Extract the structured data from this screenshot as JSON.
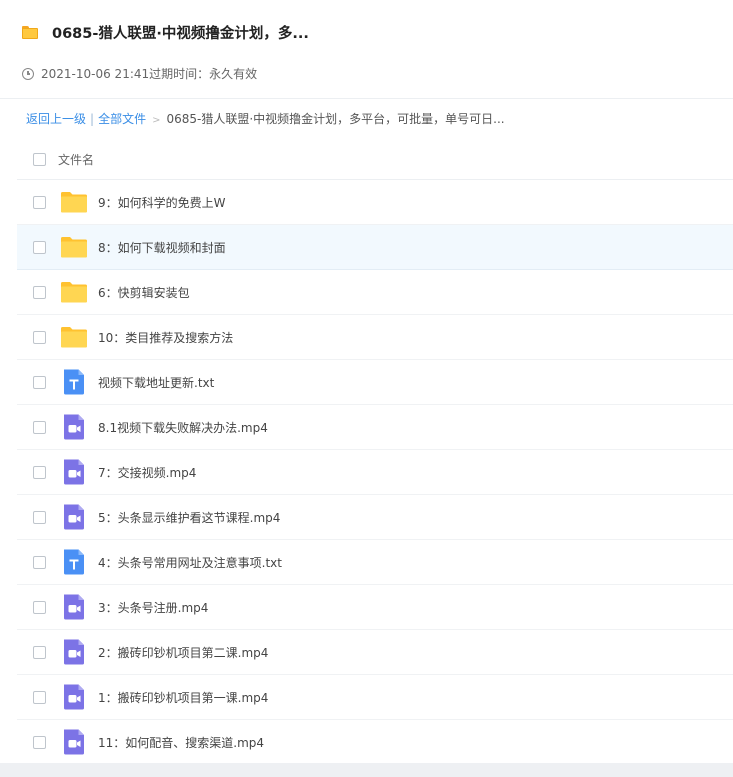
{
  "header": {
    "title": "0685-猎人联盟·中视频撸金计划，多...",
    "share_time": "2021-10-06 21:41",
    "expire_label": "过期时间：",
    "expire_value": "永久有效"
  },
  "breadcrumb": {
    "back": "返回上一级",
    "separator": "|",
    "all_files": "全部文件",
    "arrow": ">",
    "current": "0685-猎人联盟·中视频撸金计划，多平台，可批量，单号可日..."
  },
  "list": {
    "column_name": "文件名",
    "files": [
      {
        "name": "9：如何科学的免费上W",
        "icon": "folder-icon"
      },
      {
        "name": "8：如何下载视频和封面",
        "icon": "folder-icon"
      },
      {
        "name": "6：快剪辑安装包",
        "icon": "folder-icon"
      },
      {
        "name": "10：类目推荐及搜索方法",
        "icon": "folder-icon"
      },
      {
        "name": "视频下载地址更新.txt",
        "icon": "txt-file-icon"
      },
      {
        "name": "8.1视频下载失败解决办法.mp4",
        "icon": "video-file-icon"
      },
      {
        "name": "7：交接视频.mp4",
        "icon": "video-file-icon"
      },
      {
        "name": "5：头条显示维护看这节课程.mp4",
        "icon": "video-file-icon"
      },
      {
        "name": "4：头条号常用网址及注意事项.txt",
        "icon": "txt-file-icon"
      },
      {
        "name": "3：头条号注册.mp4",
        "icon": "video-file-icon"
      },
      {
        "name": "2：搬砖印钞机项目第二课.mp4",
        "icon": "video-file-icon"
      },
      {
        "name": "1：搬砖印钞机项目第一课.mp4",
        "icon": "video-file-icon"
      },
      {
        "name": "11：如何配音、搜索渠道.mp4",
        "icon": "video-file-icon"
      }
    ]
  },
  "colors": {
    "link": "#3a8ee6",
    "folder": "#ffd34f",
    "txt_icon": "#4a90f5",
    "video_icon": "#7c73e6",
    "row_highlight": "#f2f9fe"
  }
}
